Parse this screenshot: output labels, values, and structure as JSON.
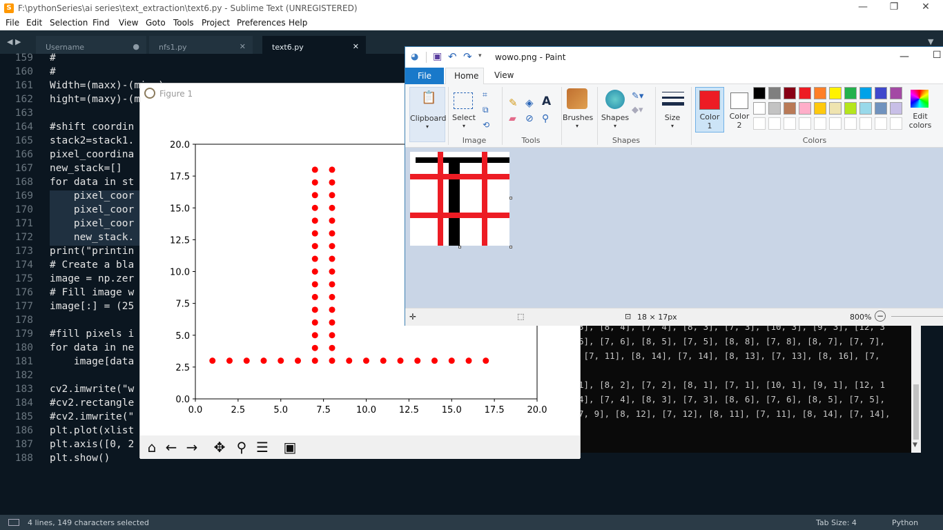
{
  "sublime": {
    "title": "F:\\pythonSeries\\ai series\\text_extraction\\text6.py - Sublime Text (UNREGISTERED)",
    "window_controls": [
      "—",
      "❐",
      "✕"
    ],
    "menu": [
      "File",
      "Edit",
      "Selection",
      "Find",
      "View",
      "Goto",
      "Tools",
      "Project",
      "Preferences",
      "Help"
    ],
    "tabs": [
      {
        "label": "Username",
        "state": "modified"
      },
      {
        "label": "nfs1.py",
        "state": "close"
      },
      {
        "label": "text6.py",
        "state": "close"
      }
    ],
    "lines": [
      {
        "n": "159",
        "code": "#"
      },
      {
        "n": "160",
        "code": "#"
      },
      {
        "n": "161",
        "code": "Width=(maxx)-(minx)"
      },
      {
        "n": "162",
        "code": "hight=(maxy)-(miny)"
      },
      {
        "n": "163",
        "code": ""
      },
      {
        "n": "164",
        "code": "#shift coordin"
      },
      {
        "n": "165",
        "code": "stack2=stack1."
      },
      {
        "n": "166",
        "code": "pixel_coordina"
      },
      {
        "n": "167",
        "code": "new_stack=[]"
      },
      {
        "n": "168",
        "code": "for data in st"
      },
      {
        "n": "169",
        "code": "    pixel_coor"
      },
      {
        "n": "170",
        "code": "    pixel_coor"
      },
      {
        "n": "171",
        "code": "    pixel_coor"
      },
      {
        "n": "172",
        "code": "    new_stack."
      },
      {
        "n": "173",
        "code": "print(\"printin"
      },
      {
        "n": "174",
        "code": "# Create a bla"
      },
      {
        "n": "175",
        "code": "image = np.zer"
      },
      {
        "n": "176",
        "code": "# Fill image w"
      },
      {
        "n": "177",
        "code": "image[:] = (25"
      },
      {
        "n": "178",
        "code": ""
      },
      {
        "n": "179",
        "code": "#fill pixels i"
      },
      {
        "n": "180",
        "code": "for data in ne"
      },
      {
        "n": "181",
        "code": "    image[data"
      },
      {
        "n": "182",
        "code": ""
      },
      {
        "n": "183",
        "code": "cv2.imwrite(\"w"
      },
      {
        "n": "184",
        "code": "#cv2.rectangle"
      },
      {
        "n": "185",
        "code": "#cv2.imwrite(\""
      },
      {
        "n": "186",
        "code": "plt.plot(xlist"
      },
      {
        "n": "187",
        "code": "plt.axis([0, 2"
      },
      {
        "n": "188",
        "code": "plt.show()"
      }
    ],
    "status": {
      "selection": "4 lines, 149 characters selected",
      "tab_size": "Tab Size: 4",
      "syntax": "Python"
    }
  },
  "console": {
    "lines": [
      "3], [8, 4], [7, 4], [8, 3], [7, 3], [10, 3], [9, 3], [12, 3",
      "6], [7, 6], [8, 5], [7, 5], [8, 8], [7, 8], [8, 7], [7, 7],",
      " [7, 11], [8, 14], [7, 14], [8, 13], [7, 13], [8, 16], [7,",
      "",
      "1], [8, 2], [7, 2], [8, 1], [7, 1], [10, 1], [9, 1], [12, 1",
      "4], [7, 4], [8, 3], [7, 3], [8, 6], [7, 6], [8, 5], [7, 5],",
      "7, 9], [8, 12], [7, 12], [8, 11], [7, 11], [8, 14], [7, 14],"
    ]
  },
  "figure": {
    "title": "Figure 1",
    "toolbar": [
      {
        "name": "home-icon",
        "glyph": "⌂"
      },
      {
        "name": "back-icon",
        "glyph": "←"
      },
      {
        "name": "forward-icon",
        "glyph": "→"
      },
      {
        "name": "pan-icon",
        "glyph": "✥"
      },
      {
        "name": "zoom-icon",
        "glyph": "⚲"
      },
      {
        "name": "configure-icon",
        "glyph": "☰"
      },
      {
        "name": "save-icon",
        "glyph": "▣"
      }
    ]
  },
  "chart_data": {
    "type": "scatter",
    "xlim": [
      0,
      20
    ],
    "ylim": [
      0,
      20
    ],
    "xticks": [
      "0.0",
      "2.5",
      "5.0",
      "7.5",
      "10.0",
      "12.5",
      "15.0",
      "17.5",
      "20.0"
    ],
    "yticks": [
      "0.0",
      "2.5",
      "5.0",
      "7.5",
      "10.0",
      "12.5",
      "15.0",
      "17.5",
      "20.0"
    ],
    "marker_color": "#ff0000",
    "grid": false,
    "points": [
      [
        1,
        3
      ],
      [
        2,
        3
      ],
      [
        3,
        3
      ],
      [
        4,
        3
      ],
      [
        5,
        3
      ],
      [
        6,
        3
      ],
      [
        7,
        3
      ],
      [
        8,
        3
      ],
      [
        9,
        3
      ],
      [
        10,
        3
      ],
      [
        11,
        3
      ],
      [
        12,
        3
      ],
      [
        13,
        3
      ],
      [
        14,
        3
      ],
      [
        15,
        3
      ],
      [
        16,
        3
      ],
      [
        17,
        3
      ],
      [
        7,
        4
      ],
      [
        7,
        5
      ],
      [
        7,
        6
      ],
      [
        7,
        7
      ],
      [
        7,
        8
      ],
      [
        7,
        9
      ],
      [
        7,
        10
      ],
      [
        7,
        11
      ],
      [
        7,
        12
      ],
      [
        7,
        13
      ],
      [
        7,
        14
      ],
      [
        7,
        15
      ],
      [
        7,
        16
      ],
      [
        7,
        17
      ],
      [
        7,
        18
      ],
      [
        8,
        4
      ],
      [
        8,
        5
      ],
      [
        8,
        6
      ],
      [
        8,
        7
      ],
      [
        8,
        8
      ],
      [
        8,
        9
      ],
      [
        8,
        10
      ],
      [
        8,
        11
      ],
      [
        8,
        12
      ],
      [
        8,
        13
      ],
      [
        8,
        14
      ],
      [
        8,
        15
      ],
      [
        8,
        16
      ],
      [
        8,
        17
      ],
      [
        8,
        18
      ]
    ]
  },
  "paint": {
    "title": "wowo.png - Paint",
    "tabs": {
      "file": "File",
      "home": "Home",
      "view": "View"
    },
    "ribbon": {
      "clipboard": "Clipboard",
      "select": "Select",
      "image": "Image",
      "tools": "Tools",
      "brushes": "Brushes",
      "shapes_btn": "Shapes",
      "shapes_grp": "Shapes",
      "size": "Size",
      "color1": "Color\n1",
      "color2": "Color\n2",
      "colors": "Colors",
      "edit_colors": "Edit\ncolors"
    },
    "color1": "#ed1c24",
    "color2": "#ffffff",
    "palette_row1": [
      "#000000",
      "#7f7f7f",
      "#880015",
      "#ed1c24",
      "#ff7f27",
      "#fff200",
      "#22b14c",
      "#00a2e8",
      "#3f48cc",
      "#a349a4"
    ],
    "palette_row2": [
      "#ffffff",
      "#c3c3c3",
      "#b97a57",
      "#ffaec9",
      "#ffc90e",
      "#efe4b0",
      "#b5e61d",
      "#99d9ea",
      "#7092be",
      "#c8bfe7"
    ],
    "status": {
      "dimensions": "18 × 17px",
      "zoom": "800%"
    }
  }
}
